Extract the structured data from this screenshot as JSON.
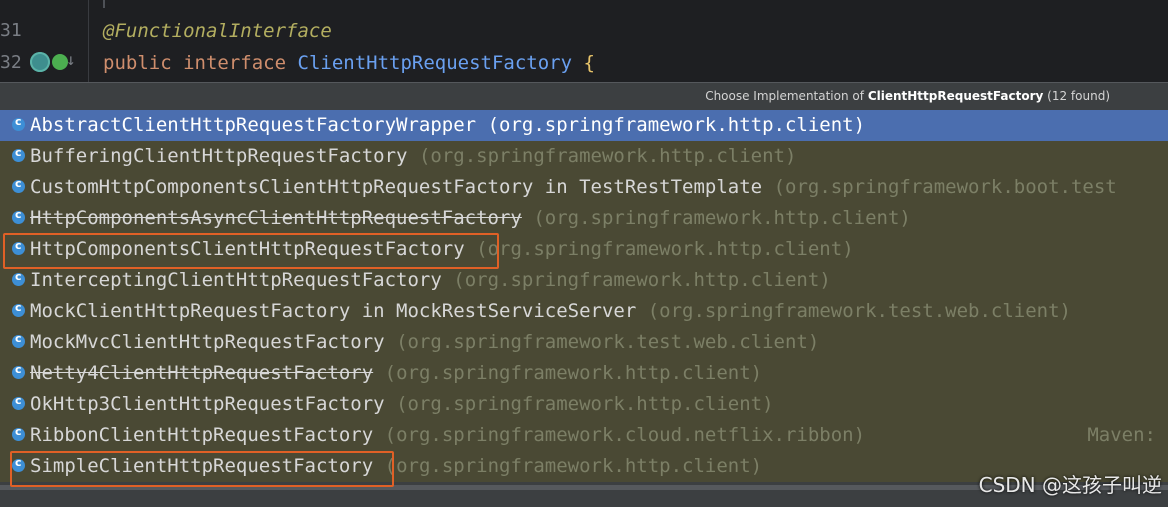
{
  "editor": {
    "line_numbers": [
      "31",
      "32"
    ],
    "annotation": "@FunctionalInterface",
    "code": {
      "kw1": "public",
      "kw2": "interface",
      "class_name": "ClientHttpRequestFactory",
      "brace": "{"
    },
    "gutter_icons": [
      "implemented-icon",
      "run-icon"
    ]
  },
  "popup": {
    "title_prefix": "Choose Implementation of",
    "title_class": "ClientHttpRequestFactory",
    "title_suffix": "(12 found)",
    "items": [
      {
        "name": "AbstractClientHttpRequestFactoryWrapper",
        "in": "",
        "pkg": "(org.springframework.http.client)",
        "selected": true,
        "deprecated": false
      },
      {
        "name": "BufferingClientHttpRequestFactory",
        "in": "",
        "pkg": "(org.springframework.http.client)",
        "selected": false,
        "deprecated": false
      },
      {
        "name": "CustomHttpComponentsClientHttpRequestFactory",
        "in": " in TestRestTemplate",
        "pkg": "(org.springframework.boot.test",
        "selected": false,
        "deprecated": false
      },
      {
        "name": "HttpComponentsAsyncClientHttpRequestFactory",
        "in": "",
        "pkg": "(org.springframework.http.client)",
        "selected": false,
        "deprecated": true
      },
      {
        "name": "HttpComponentsClientHttpRequestFactory",
        "in": "",
        "pkg": "(org.springframework.http.client)",
        "selected": false,
        "deprecated": false
      },
      {
        "name": "InterceptingClientHttpRequestFactory",
        "in": "",
        "pkg": "(org.springframework.http.client)",
        "selected": false,
        "deprecated": false
      },
      {
        "name": "MockClientHttpRequestFactory",
        "in": " in MockRestServiceServer",
        "pkg": "(org.springframework.test.web.client)",
        "selected": false,
        "deprecated": false
      },
      {
        "name": "MockMvcClientHttpRequestFactory",
        "in": "",
        "pkg": "(org.springframework.test.web.client)",
        "selected": false,
        "deprecated": false
      },
      {
        "name": "Netty4ClientHttpRequestFactory",
        "in": "",
        "pkg": "(org.springframework.http.client)",
        "selected": false,
        "deprecated": true
      },
      {
        "name": "OkHttp3ClientHttpRequestFactory",
        "in": "",
        "pkg": "(org.springframework.http.client)",
        "selected": false,
        "deprecated": false
      },
      {
        "name": "RibbonClientHttpRequestFactory",
        "in": "",
        "pkg": "(org.springframework.cloud.netflix.ribbon)",
        "selected": false,
        "deprecated": false,
        "extra": "Maven:"
      },
      {
        "name": "SimpleClientHttpRequestFactory",
        "in": "",
        "pkg": "(org.springframework.http.client)",
        "selected": false,
        "deprecated": false
      }
    ]
  },
  "watermark": "CSDN @这孩子叫逆",
  "colors": {
    "highlight_box": "#e06026",
    "selection": "#4b6eaf"
  }
}
